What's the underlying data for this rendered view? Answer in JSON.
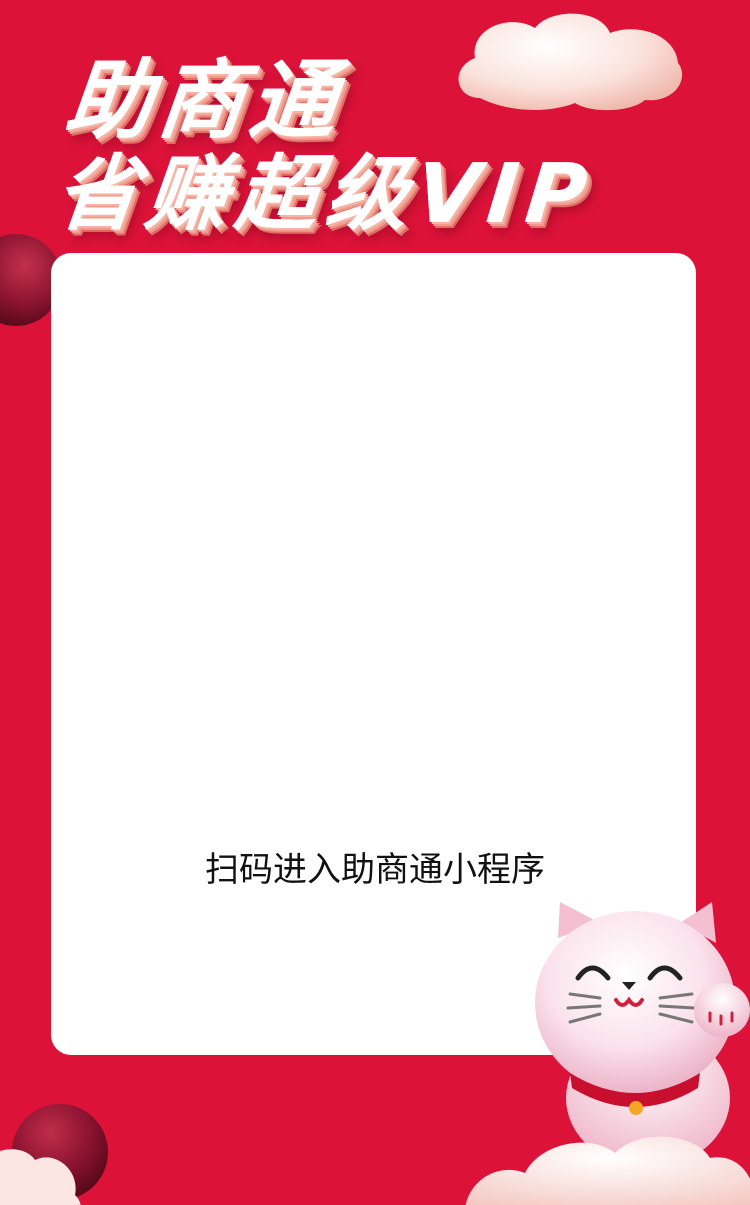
{
  "headline": {
    "line1": "助商通",
    "line2": "省赚超级VIP"
  },
  "card": {
    "caption": "扫码进入助商通小程序"
  },
  "colors": {
    "background": "#dc1239",
    "card": "#ffffff",
    "ball": "#8e1530",
    "cloud": "#fbe6e4",
    "cat": "#f6c9d7"
  },
  "decorations": [
    "cloud-top-right",
    "ball-left",
    "ball-bottom-left",
    "cloud-bottom",
    "lucky-cat-mascot"
  ]
}
